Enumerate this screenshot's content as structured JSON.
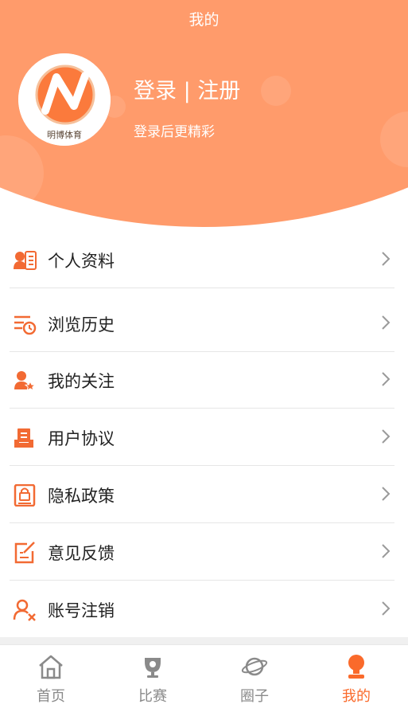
{
  "header": {
    "title": "我的",
    "login_title": "登录 | 注册",
    "login_subtitle": "登录后更精彩",
    "avatar_text": "明博体育"
  },
  "menu": {
    "items": [
      {
        "label": "个人资料",
        "icon": "profile-card-icon"
      },
      {
        "label": "浏览历史",
        "icon": "history-icon"
      },
      {
        "label": "我的关注",
        "icon": "follow-star-icon"
      },
      {
        "label": "用户协议",
        "icon": "agreement-icon"
      },
      {
        "label": "隐私政策",
        "icon": "privacy-lock-icon"
      },
      {
        "label": "意见反馈",
        "icon": "feedback-edit-icon"
      },
      {
        "label": "账号注销",
        "icon": "account-cancel-icon"
      }
    ]
  },
  "tabbar": {
    "tabs": [
      {
        "label": "首页",
        "icon": "home-icon"
      },
      {
        "label": "比赛",
        "icon": "trophy-icon"
      },
      {
        "label": "圈子",
        "icon": "planet-icon"
      },
      {
        "label": "我的",
        "icon": "user-icon"
      }
    ],
    "active_index": 3
  },
  "colors": {
    "header_bg": "#ff9b6b",
    "accent": "#fa6a2b",
    "icon": "#f26a33",
    "tab_inactive": "#8a8a8a"
  }
}
